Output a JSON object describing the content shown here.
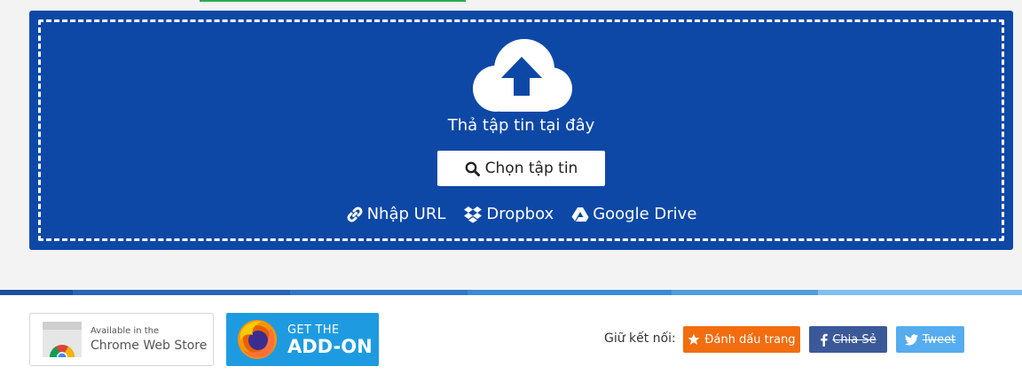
{
  "top_progress": {
    "value_percent": 100,
    "color": "#2eaa4a"
  },
  "upload": {
    "drop_text": "Thả tập tin tại đây",
    "choose_label": "Chọn tập tin",
    "sources": [
      {
        "label": "Nhập URL",
        "icon": "link-icon"
      },
      {
        "label": "Dropbox",
        "icon": "dropbox-icon"
      },
      {
        "label": "Google Drive",
        "icon": "google-drive-icon"
      }
    ],
    "bg_color": "#0e48a6"
  },
  "footer": {
    "chrome_badge": {
      "line1": "Available in the",
      "line2": "Chrome Web Store"
    },
    "firefox_badge": {
      "line1": "GET THE",
      "line2": "ADD-ON"
    },
    "connect_label": "Giữ kết nối:",
    "share_buttons": {
      "bookmark": {
        "label": "Đánh dấu trang",
        "color": "#f26d0f",
        "icon": "star-icon"
      },
      "facebook": {
        "label": "Chia Sẻ",
        "color": "#3b5998",
        "icon": "facebook-icon"
      },
      "twitter": {
        "label": "Tweet",
        "color": "#55acee",
        "icon": "twitter-icon"
      }
    }
  },
  "stripe_colors": [
    "#1a50a0",
    "#2766b8",
    "#2f78c9",
    "#3a8ad6",
    "#4e9fe0",
    "#7fbff0"
  ]
}
